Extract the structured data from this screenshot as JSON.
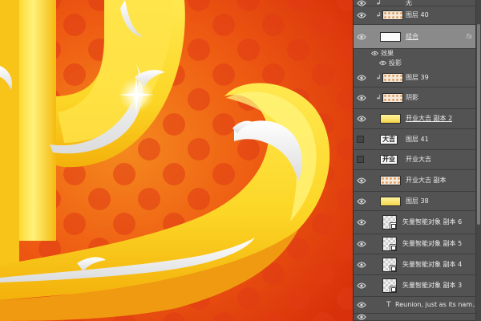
{
  "canvas": {
    "description_free": true
  },
  "layers": [
    {
      "id": "top",
      "name": "无",
      "visible": true,
      "clip": true,
      "thumb": "checker"
    },
    {
      "id": "layer40",
      "name": "图层 40",
      "visible": true,
      "clip": true,
      "thumb": "dots"
    },
    {
      "id": "group",
      "name": "组合",
      "visible": true,
      "clip": false,
      "thumb": "white",
      "fx": "fx",
      "selected": true,
      "underline": true
    },
    {
      "id": "effects",
      "name": "效果",
      "sub": true
    },
    {
      "id": "shadow",
      "name": "投影",
      "sub": true
    },
    {
      "id": "layer39",
      "name": "图层 39",
      "visible": true,
      "clip": true,
      "thumb": "dots"
    },
    {
      "id": "yinying",
      "name": "阴影",
      "visible": true,
      "clip": true,
      "thumb": "dots"
    },
    {
      "id": "kaigong2",
      "name": "开业大吉 副本 2",
      "visible": true,
      "clip": false,
      "thumb": "yellow",
      "underline": true
    },
    {
      "id": "layer41",
      "name": "图层 41",
      "visible": false,
      "clip": false,
      "thumb": "text",
      "thumb_text": "大吉"
    },
    {
      "id": "kaigong",
      "name": "开业大吉",
      "visible": false,
      "clip": false,
      "thumb": "text",
      "thumb_text": "开业"
    },
    {
      "id": "kaigong1",
      "name": "开业大吉 副本",
      "visible": true,
      "clip": false,
      "thumb": "dots"
    },
    {
      "id": "layer38",
      "name": "图层 38",
      "visible": true,
      "clip": false,
      "thumb": "yellow"
    },
    {
      "id": "so6",
      "name": "矢量智能对象 副本 6",
      "visible": true,
      "clip": false,
      "thumb": "so"
    },
    {
      "id": "so5",
      "name": "矢量智能对象 副本 5",
      "visible": true,
      "clip": false,
      "thumb": "so"
    },
    {
      "id": "so4",
      "name": "矢量智能对象 副本 4",
      "visible": true,
      "clip": false,
      "thumb": "so"
    },
    {
      "id": "so3",
      "name": "矢量智能对象 副本 3",
      "visible": true,
      "clip": false,
      "thumb": "so"
    },
    {
      "id": "text1",
      "name": "Reunion, just as its nam...",
      "visible": true,
      "clip": false,
      "thumb": "type",
      "type_glyph": "T"
    },
    {
      "id": "bottom",
      "name": "",
      "visible": true,
      "clip": false,
      "thumb": "checker"
    }
  ]
}
